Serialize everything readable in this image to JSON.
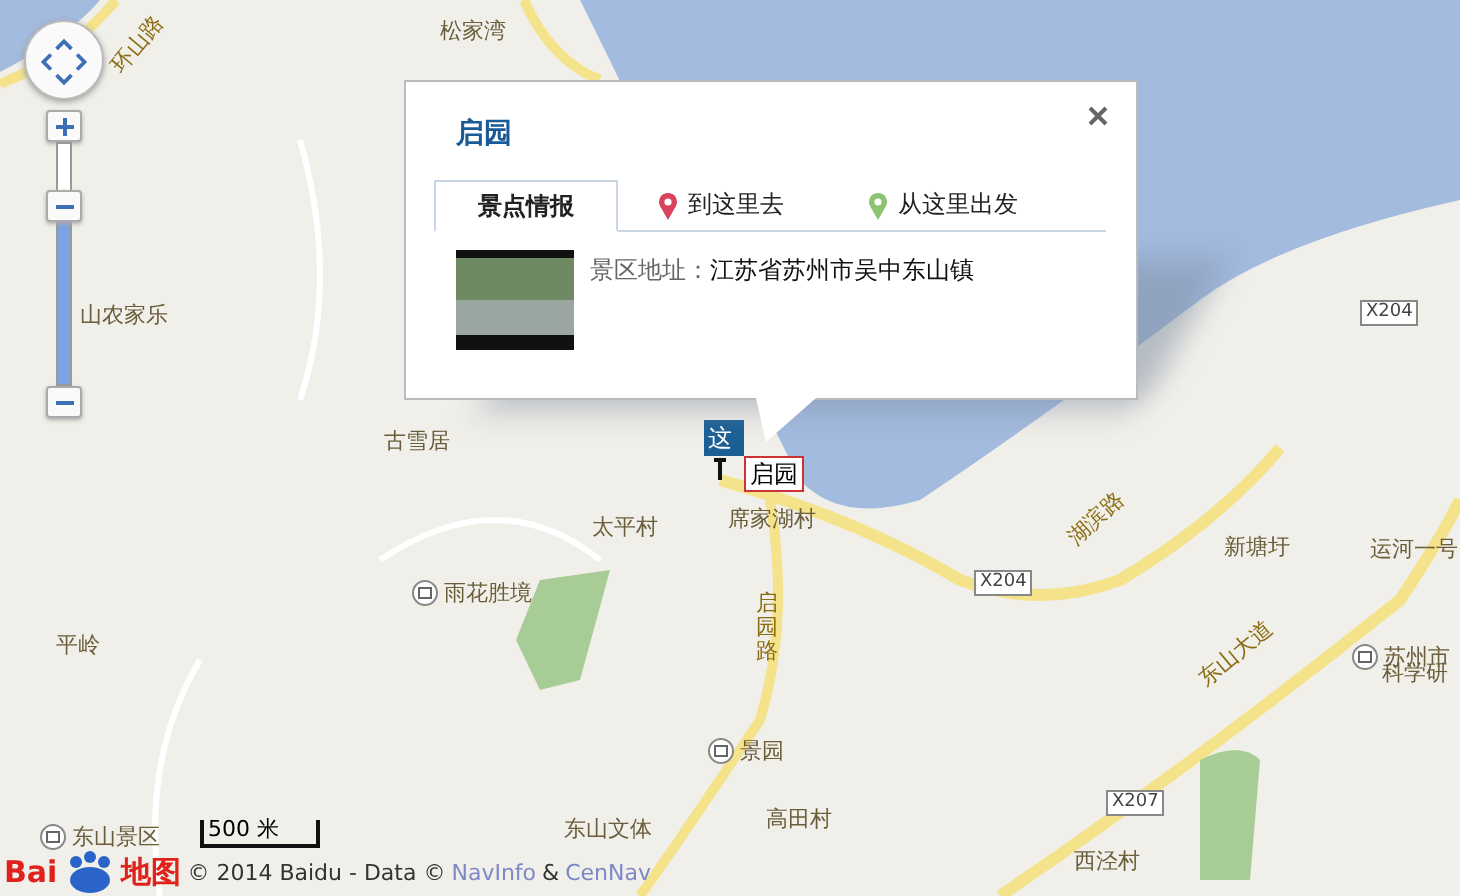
{
  "map": {
    "labels": [
      {
        "text": "环山路",
        "kind": "road"
      },
      {
        "text": "松家湾",
        "kind": "place"
      },
      {
        "text": "山农家乐",
        "kind": "place"
      },
      {
        "text": "古雪居",
        "kind": "place"
      },
      {
        "text": "太平村",
        "kind": "place"
      },
      {
        "text": "雨花胜境",
        "kind": "poi"
      },
      {
        "text": "平岭",
        "kind": "place"
      },
      {
        "text": "东山景区",
        "kind": "poi"
      },
      {
        "text": "席家湖村",
        "kind": "place"
      },
      {
        "text": "启园路",
        "kind": "vroad"
      },
      {
        "text": "X204",
        "kind": "shield"
      },
      {
        "text": "X204",
        "kind": "shield"
      },
      {
        "text": "X207",
        "kind": "shield"
      },
      {
        "text": "湖滨路",
        "kind": "road"
      },
      {
        "text": "新塘圩",
        "kind": "place"
      },
      {
        "text": "运河一号",
        "kind": "place"
      },
      {
        "text": "苏州市",
        "kind": "poi"
      },
      {
        "text": "科学研",
        "kind": "place"
      },
      {
        "text": "东山大道",
        "kind": "road"
      },
      {
        "text": "景园",
        "kind": "poi"
      },
      {
        "text": "高田村",
        "kind": "place"
      },
      {
        "text": "西泾村",
        "kind": "place"
      },
      {
        "text": "东山文体",
        "kind": "place"
      }
    ],
    "marker": {
      "text": "这"
    },
    "marker_label": "启园",
    "scale": "500 米"
  },
  "info_window": {
    "title": "启园",
    "tabs": [
      {
        "label": "景点情报",
        "selected": true,
        "kind": "plain"
      },
      {
        "label": "到这里去",
        "selected": false,
        "kind": "to"
      },
      {
        "label": "从这里出发",
        "selected": false,
        "kind": "from"
      }
    ],
    "address_label": "景区地址：",
    "address": "江苏省苏州市吴中东山镇"
  },
  "footer": {
    "logo": {
      "left": "Bai",
      "right": "地图"
    },
    "copyright": "© 2014 Baidu - Data ©",
    "links": [
      "NavInfo",
      "CenNav"
    ],
    "separator": "&"
  }
}
